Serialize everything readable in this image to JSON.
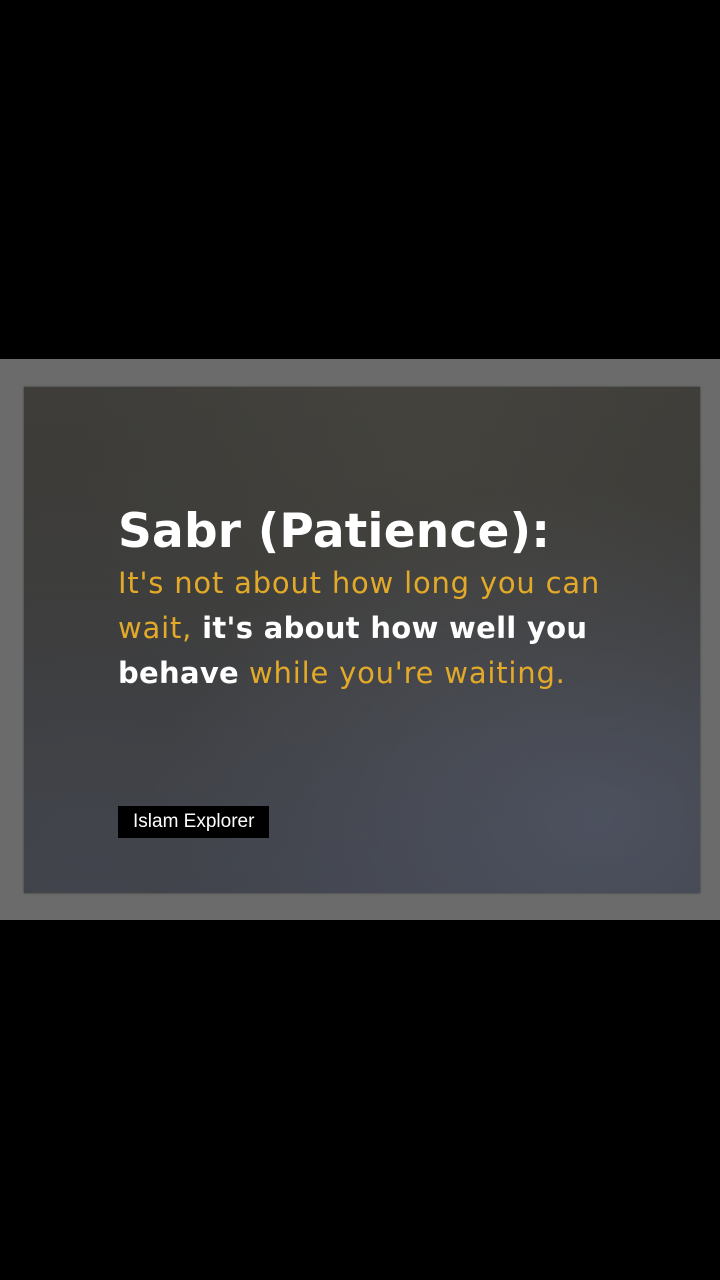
{
  "quote": {
    "title": "Sabr (Patience):",
    "segments": [
      {
        "text": "It's not about how long you can wait, ",
        "emphasis": false
      },
      {
        "text": "it's about how well you behave",
        "emphasis": true
      },
      {
        "text": " while you're waiting.",
        "emphasis": false
      }
    ]
  },
  "brand": {
    "name": "Islam Explorer"
  },
  "colors": {
    "viewer_background": "#000000",
    "frame": "#6a6b6a",
    "card_background": "#3c3c3a",
    "accent_text": "#e3a928",
    "emphasis_text": "#ffffff",
    "badge_background": "#000000"
  }
}
